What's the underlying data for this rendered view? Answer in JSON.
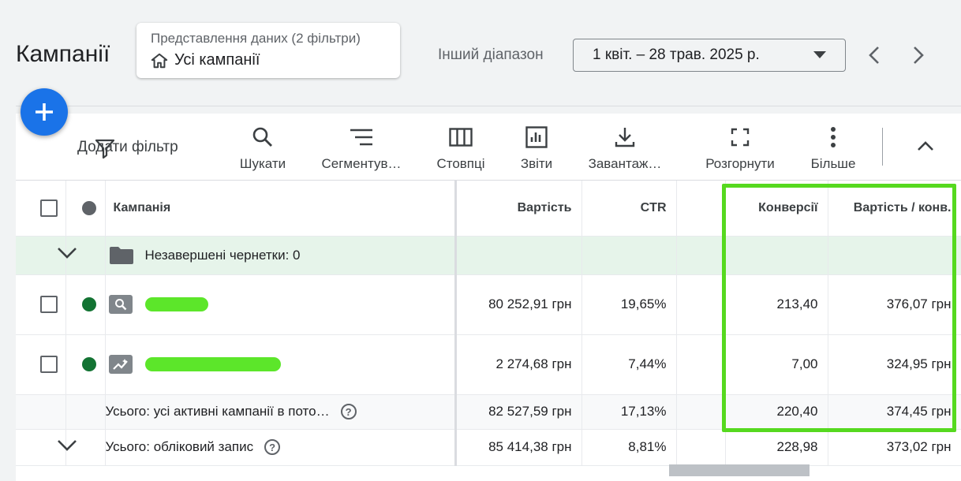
{
  "header": {
    "title": "Кампанії",
    "view": {
      "subtitle": "Представлення даних (2 фільтри)",
      "name": "Усі кампанії"
    },
    "date_range": {
      "label": "Інший діапазон",
      "value": "1 квіт. – 28 трав. 2025 р."
    }
  },
  "toolbar": {
    "add_filter": "Додати фільтр",
    "items": [
      {
        "label": "Шукати",
        "icon": "search-icon"
      },
      {
        "label": "Сегментув…",
        "icon": "segment-icon"
      },
      {
        "label": "Стовпці",
        "icon": "columns-icon"
      },
      {
        "label": "Звіти",
        "icon": "reports-icon"
      },
      {
        "label": "Завантаж…",
        "icon": "download-icon"
      },
      {
        "label": "Розгорнути",
        "icon": "expand-icon"
      },
      {
        "label": "Більше",
        "icon": "more-vert-icon"
      }
    ]
  },
  "table": {
    "headers": {
      "campaign": "Кампанія",
      "cost": "Вартість",
      "ctr": "CTR",
      "conversions": "Конверсії",
      "cost_per_conv": "Вартість / конв."
    },
    "drafts": "Незавершені чернетки: 0",
    "rows": [
      {
        "status_color": "#137333",
        "icon": "search-campaign-icon",
        "cost": "80 252,91 грн",
        "ctr": "19,65%",
        "conversions": "213,40",
        "cost_per_conv": "376,07 грн"
      },
      {
        "status_color": "#137333",
        "icon": "performance-campaign-icon",
        "cost": "2 274,68 грн",
        "ctr": "7,44%",
        "conversions": "7,00",
        "cost_per_conv": "324,95 грн"
      }
    ],
    "total_active": {
      "label": "Усього: усі активні кампанії в пото…",
      "cost": "82 527,59 грн",
      "ctr": "17,13%",
      "conversions": "220,40",
      "cost_per_conv": "374,45 грн"
    },
    "total_account": {
      "label": "Усього: обліковий запис",
      "cost": "85 414,38 грн",
      "ctr": "8,81%",
      "conversions": "228,98",
      "cost_per_conv": "373,02 грн"
    }
  },
  "colors": {
    "accent": "#1a73e8",
    "highlight": "#56d91f",
    "redaction": "#5ce62a",
    "active_status": "#137333"
  }
}
